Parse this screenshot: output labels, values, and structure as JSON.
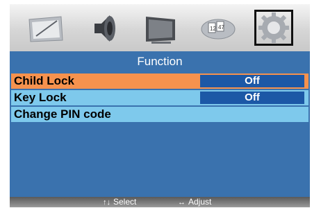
{
  "tabs": [
    {
      "icon": "picture-icon"
    },
    {
      "icon": "speaker-icon"
    },
    {
      "icon": "monitor-icon"
    },
    {
      "icon": "timer-icon"
    },
    {
      "icon": "gear-icon"
    }
  ],
  "active_tab": "gear-icon",
  "panel": {
    "title": "Function"
  },
  "menu": [
    {
      "label": "Child Lock",
      "value": "Off"
    },
    {
      "label": "Key Lock",
      "value": "Off"
    },
    {
      "label": "Change PIN code"
    }
  ],
  "footer": {
    "select_glyph": "↑↓",
    "select_label": "Select",
    "adjust_glyph": "↔",
    "adjust_label": "Adjust"
  },
  "colors": {
    "panel_bg": "#3a72ae",
    "selected_row": "#f6924e",
    "row_bg": "#7ec9ec",
    "value_bg": "#1c58a6"
  }
}
